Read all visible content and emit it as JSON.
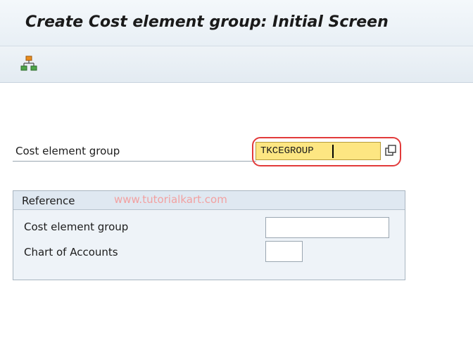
{
  "window": {
    "title": "Create Cost element group: Initial Screen"
  },
  "toolbar": {
    "hierarchy_icon": "hierarchy-icon"
  },
  "main": {
    "cost_element_group_label": "Cost element group",
    "cost_element_group_value": "TKCEGROUP"
  },
  "reference": {
    "title": "Reference",
    "cost_element_group_label": "Cost element group",
    "cost_element_group_value": "",
    "chart_of_accounts_label": "Chart of Accounts",
    "chart_of_accounts_value": ""
  },
  "watermark": "www.tutorialkart.com",
  "colors": {
    "input_highlight": "#fde682",
    "annotation_red": "#e23a3a",
    "watermark": "#f2a1a1"
  }
}
